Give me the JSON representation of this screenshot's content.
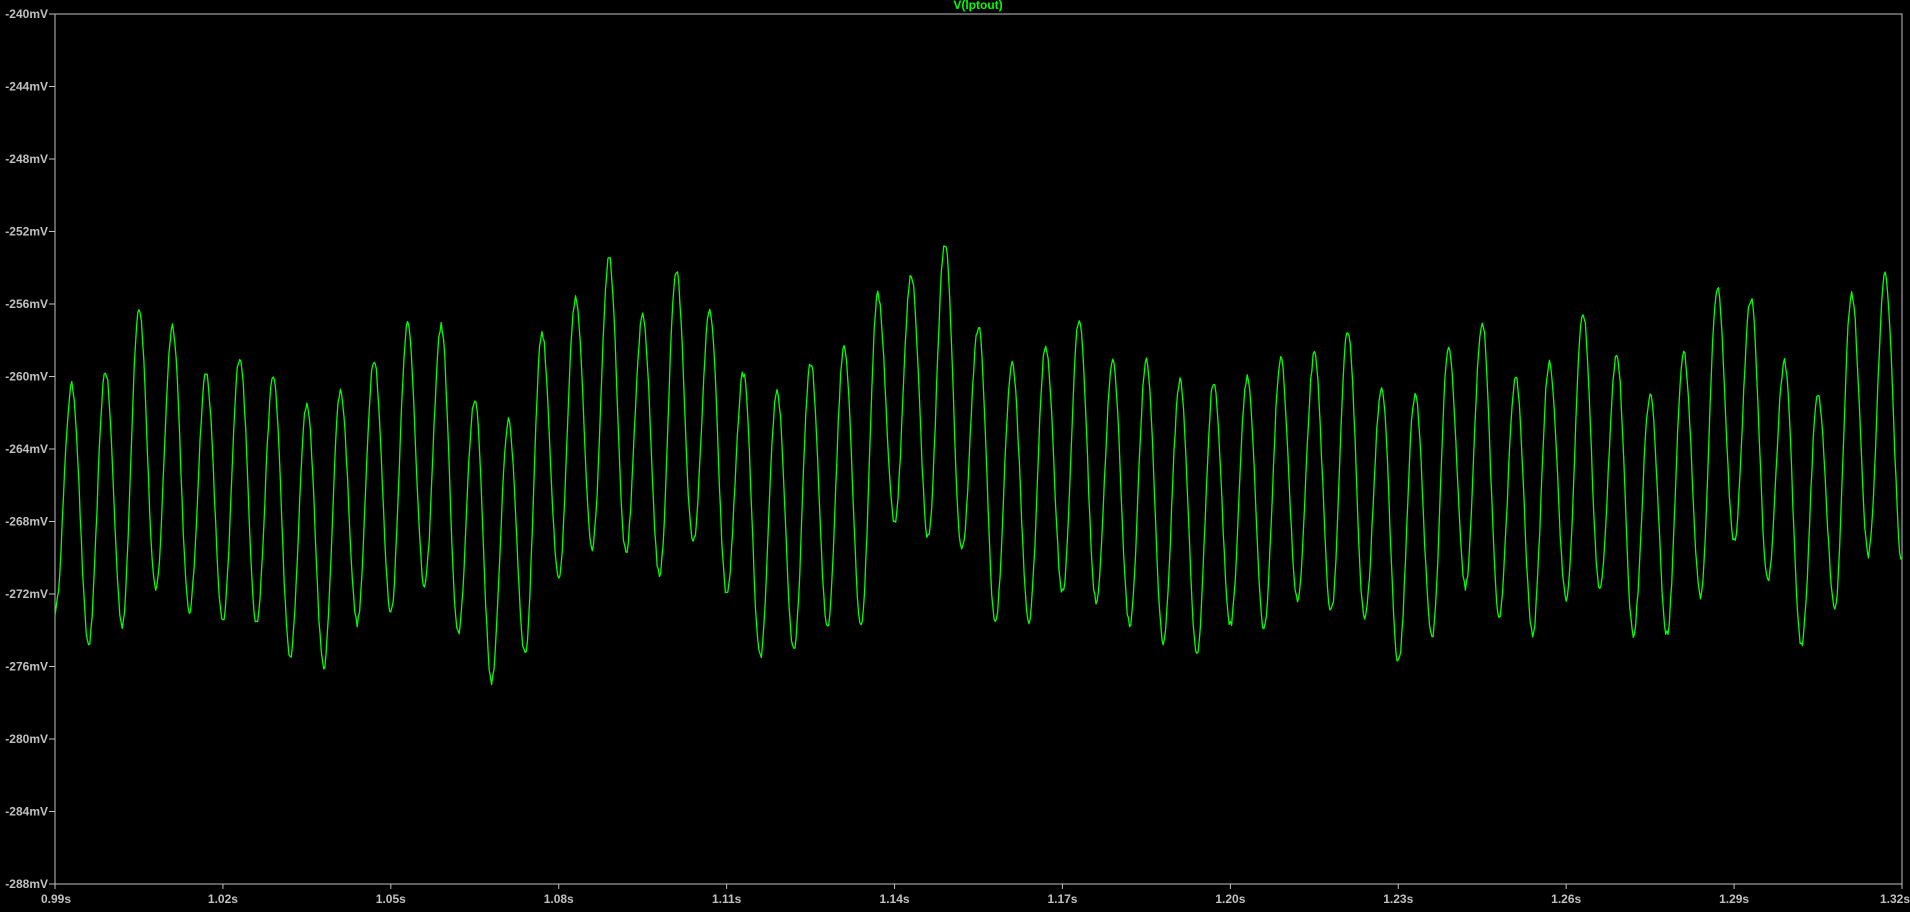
{
  "chart_data": {
    "type": "line",
    "title": "V(lptout)",
    "xlabel": "",
    "ylabel": "",
    "xlim": [
      0.99,
      1.32
    ],
    "ylim": [
      -288,
      -240
    ],
    "x_unit": "s",
    "y_unit": "mV",
    "grid": false,
    "x_ticks": [
      "0.99s",
      "1.02s",
      "1.05s",
      "1.08s",
      "1.11s",
      "1.14s",
      "1.17s",
      "1.20s",
      "1.23s",
      "1.26s",
      "1.29s",
      "1.32s"
    ],
    "y_ticks": [
      "-240mV",
      "-244mV",
      "-248mV",
      "-252mV",
      "-256mV",
      "-260mV",
      "-264mV",
      "-268mV",
      "-272mV",
      "-276mV",
      "-280mV",
      "-284mV",
      "-288mV"
    ],
    "series": [
      {
        "name": "V(lptout)",
        "color": "#00ff00",
        "x_start": 0.99,
        "period": 0.006,
        "extrema": [
          -273.0,
          -260.5,
          -274.8,
          -259.7,
          -273.7,
          -256.2,
          -271.8,
          -257.2,
          -273.0,
          -259.8,
          -273.6,
          -258.9,
          -273.6,
          -260.0,
          -275.5,
          -261.5,
          -276.0,
          -260.8,
          -273.6,
          -259.0,
          -273.0,
          -257.1,
          -271.6,
          -257.2,
          -274.2,
          -261.2,
          -276.8,
          -262.5,
          -275.3,
          -257.6,
          -271.2,
          -255.7,
          -269.4,
          -253.4,
          -269.7,
          -256.7,
          -271.0,
          -254.2,
          -269.2,
          -256.4,
          -272.0,
          -259.8,
          -275.5,
          -260.8,
          -275.2,
          -259.2,
          -273.8,
          -258.3,
          -273.7,
          -255.5,
          -268.0,
          -254.4,
          -268.9,
          -252.6,
          -269.6,
          -257.3,
          -273.6,
          -259.3,
          -273.5,
          -258.3,
          -271.9,
          -256.9,
          -272.4,
          -259.2,
          -273.7,
          -259.2,
          -274.6,
          -260.2,
          -275.3,
          -260.3,
          -273.7,
          -260.0,
          -274.0,
          -259.1,
          -272.4,
          -258.8,
          -273.0,
          -257.4,
          -273.4,
          -260.6,
          -275.8,
          -261.0,
          -274.4,
          -258.5,
          -271.6,
          -257.0,
          -273.2,
          -260.1,
          -274.2,
          -259.2,
          -272.3,
          -256.5,
          -271.8,
          -258.8,
          -274.2,
          -261.0,
          -274.2,
          -258.7,
          -272.1,
          -255.1,
          -269.1,
          -255.7,
          -271.2,
          -259.2,
          -274.9,
          -261.0,
          -272.8,
          -255.4,
          -269.8,
          -254.4,
          -270.3,
          -256.9,
          -272.9,
          -260.6
        ]
      }
    ]
  }
}
